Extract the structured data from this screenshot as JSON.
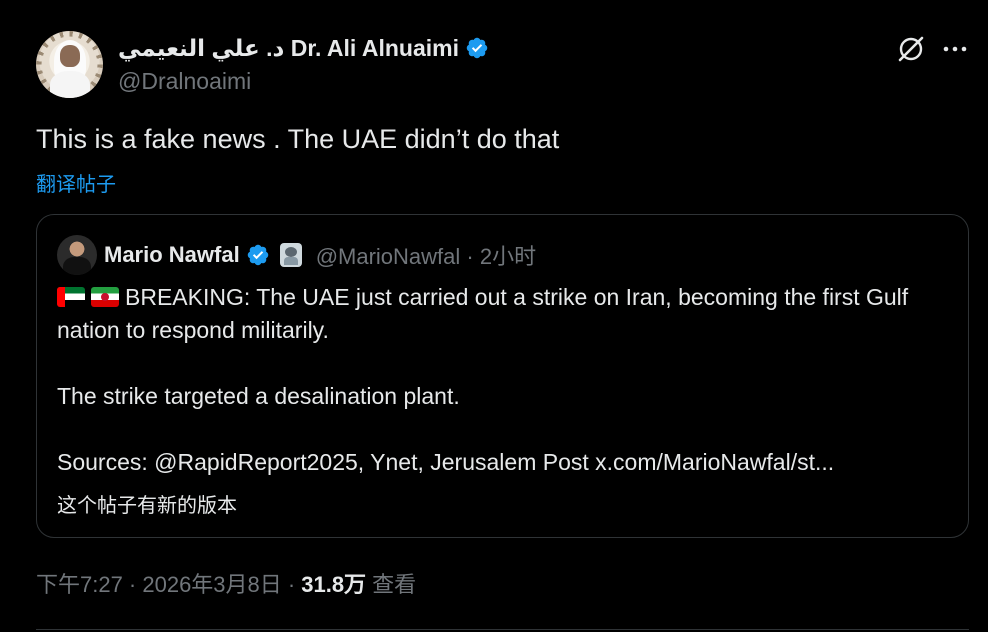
{
  "author": {
    "display_name": "د. علي النعيمي Dr. Ali Alnuaimi",
    "handle": "@Dralnoaimi",
    "verified": true
  },
  "tweet": {
    "text": "This is a fake news . The UAE didn’t do that",
    "translate_label": "翻译帖子"
  },
  "quoted": {
    "display_name": "Mario Nawfal",
    "handle_time": "@MarioNawfal · 2小时",
    "lines": [
      "BREAKING: The UAE just carried out a strike on Iran, becoming the first Gulf nation to respond militarily.",
      "The strike targeted a desalination plant.",
      "Sources: @RapidReport2025, Ynet, Jerusalem Post x.com/MarioNawfal/st..."
    ],
    "new_version_notice": "这个帖子有新的版本"
  },
  "meta": {
    "timestamp": "下午7:27 · 2026年3月8日 ·",
    "views_count": "31.8万",
    "views_label": "查看"
  },
  "icons": {
    "verified": "verified-badge-icon",
    "grok": "grok-icon",
    "more": "more-options-icon"
  },
  "colors": {
    "background": "#000000",
    "text": "#e7e9ea",
    "secondary": "#71767b",
    "accent": "#1d9bf0",
    "border": "#2f3336"
  }
}
